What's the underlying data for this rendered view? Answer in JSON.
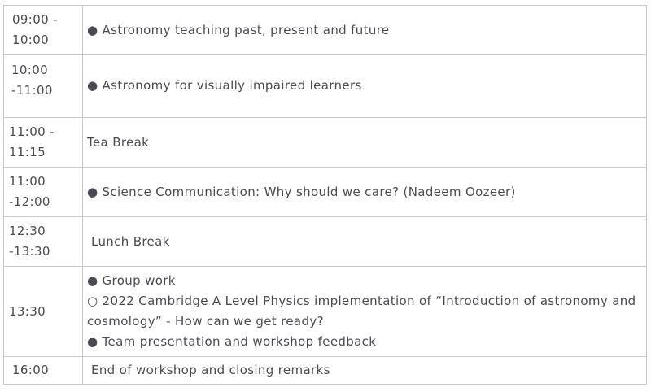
{
  "rows": [
    {
      "time": [
        "09:00 -",
        "10:00"
      ],
      "items": [
        "● Astronomy teaching past, present and future"
      ]
    },
    {
      "time": [
        "10:00",
        "-11:00"
      ],
      "items": [
        "● Astronomy for visually impaired learners"
      ]
    },
    {
      "time": [
        "11:00 -",
        "11:15"
      ],
      "items": [
        "Tea Break"
      ]
    },
    {
      "time": [
        "11:00",
        "-12:00"
      ],
      "items": [
        "● Science Communication: Why should we care? (Nadeem Oozeer)"
      ]
    },
    {
      "time": [
        "12:30",
        "-13:30"
      ],
      "items": [
        "Lunch Break"
      ]
    },
    {
      "time": [
        "13:30"
      ],
      "items": [
        "● Group work",
        "○ 2022 Cambridge A Level Physics implementation of “Introduction of astronomy and cosmology” - How can we get ready?",
        "● Team presentation and workshop feedback"
      ]
    },
    {
      "time": [
        "16:00"
      ],
      "items": [
        "End of workshop and closing remarks"
      ]
    }
  ]
}
